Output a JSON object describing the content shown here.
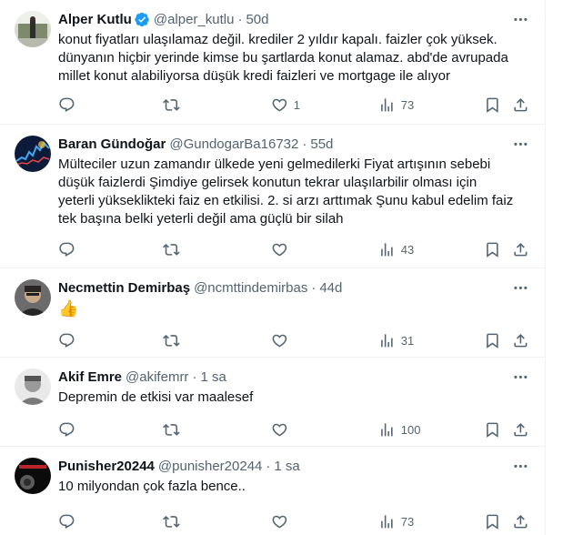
{
  "colors": {
    "text": "#0f1419",
    "secondary": "#536471",
    "verified": "#1d9bf0",
    "border": "#eff3f4"
  },
  "tweets": [
    {
      "name": "Alper Kutlu",
      "verified": true,
      "handle": "@alper_kutlu",
      "time": "50d",
      "lines": [
        "konut fiyatları ulaşılamaz değil. krediler 2 yıldır kapalı. faizler çok yüksek.",
        "dünyanın hiçbir yerinde kimse bu şartlarda konut alamaz. abd'de avrupada",
        "millet konut alabiliyorsa düşük kredi faizleri ve mortgage ile alıyor"
      ],
      "likes": "1",
      "views": "73"
    },
    {
      "name": "Baran Gündoğar",
      "verified": false,
      "handle": "@GundogarBa16732",
      "time": "55d",
      "lines": [
        "Mülteciler uzun zamandır ülkede yeni gelmedilerki Fiyat artışının sebebi",
        "düşük faizlerdi Şimdiye gelirsek konutun tekrar ulaşılarbilir olması için",
        "yeterli yükseklikteki faiz en etkilisi. 2. si arzı arttımak Şunu kabul edelim faiz",
        "tek başına belki yeterli değil ama güçlü bir silah"
      ],
      "likes": "",
      "views": "43"
    },
    {
      "name": "Necmettin Demirbaş",
      "verified": false,
      "handle": "@ncmttindemirbas",
      "time": "44d",
      "lines": [
        "👍"
      ],
      "likes": "",
      "views": "31"
    },
    {
      "name": "Akif Emre",
      "verified": false,
      "handle": "@akifemrr",
      "time": "1 sa",
      "lines": [
        "Depremin de etkisi var maalesef"
      ],
      "likes": "",
      "views": "100"
    },
    {
      "name": "Punisher20244",
      "verified": false,
      "handle": "@punisher20244",
      "time": "1 sa",
      "lines": [
        "10 milyondan çok fazla bence.."
      ],
      "likes": "",
      "views": "73"
    }
  ],
  "icons": {
    "reply": "reply-icon",
    "retweet": "retweet-icon",
    "like": "heart-icon",
    "views": "views-icon",
    "bookmark": "bookmark-icon",
    "share": "share-icon",
    "more": "more-icon",
    "verified": "verified-badge-icon"
  }
}
